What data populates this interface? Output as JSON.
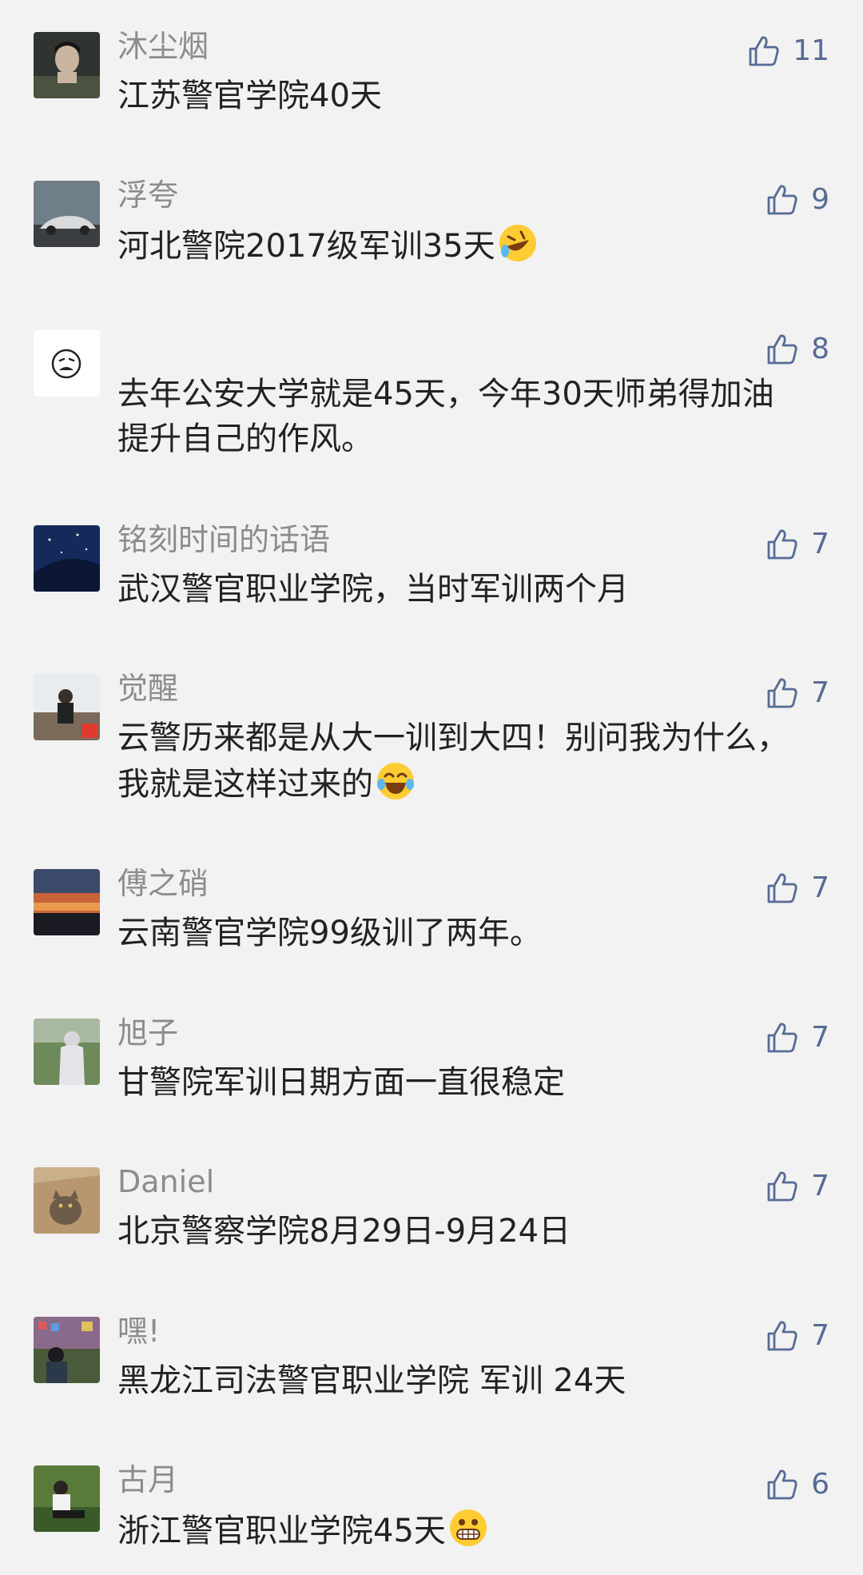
{
  "comments": [
    {
      "name": "沐尘烟",
      "text": "江苏警官学院40天",
      "likes": "11",
      "avatar_icon": "avatar-young-man"
    },
    {
      "name": "浮夸",
      "text": "河北警院2017级军训35天",
      "likes": "9",
      "avatar_icon": "avatar-car",
      "emoji": "rolling-laugh-emoji"
    },
    {
      "name": "",
      "text": "去年公安大学就是45天，今年30天师弟得加油提升自己的作风。",
      "likes": "8",
      "avatar_icon": "avatar-cartoon-face"
    },
    {
      "name": "铭刻时间的话语",
      "text": "武汉警官职业学院，当时军训两个月",
      "likes": "7",
      "avatar_icon": "avatar-night-sky"
    },
    {
      "name": "觉醒",
      "text": "云警历来都是从大一训到大四！别问我为什么，我就是这样过来的",
      "likes": "7",
      "avatar_icon": "avatar-photographer",
      "emoji": "tears-of-joy-emoji"
    },
    {
      "name": "傅之硝",
      "text": "云南警官学院99级训了两年。",
      "likes": "7",
      "avatar_icon": "avatar-sunset"
    },
    {
      "name": "旭子",
      "text": "甘警院军训日期方面一直很稳定",
      "likes": "7",
      "avatar_icon": "avatar-outdoor-person"
    },
    {
      "name": "Daniel",
      "text": "北京警察学院8月29日-9月24日",
      "likes": "7",
      "avatar_icon": "avatar-cat"
    },
    {
      "name": "嘿!",
      "text": "黑龙江司法警官职业学院 军训 24天",
      "likes": "7",
      "avatar_icon": "avatar-shop"
    },
    {
      "name": "古月",
      "text": "浙江警官职业学院45天",
      "likes": "6",
      "avatar_icon": "avatar-sitting-man",
      "emoji": "grimacing-emoji"
    }
  ],
  "colors": {
    "background": "#f2f2f2",
    "name": "#8c8c8c",
    "text": "#222222",
    "like": "#576b95"
  }
}
